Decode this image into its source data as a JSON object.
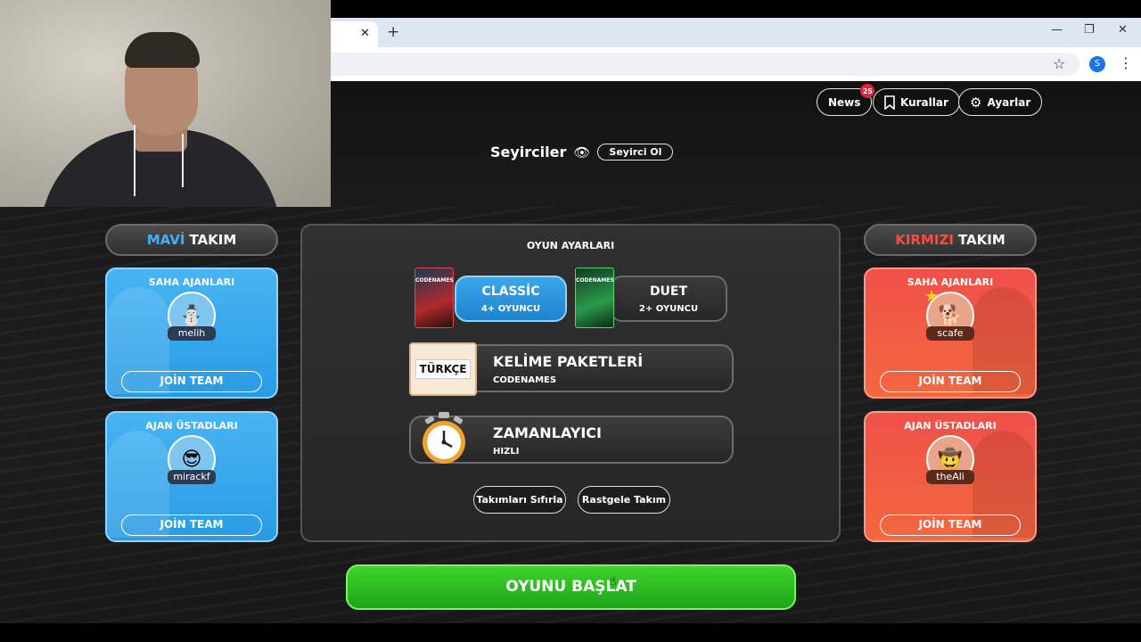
{
  "browser": {
    "tab_close": "✕",
    "new_tab": "+",
    "minimize": "—",
    "restore": "❐",
    "close": "✕",
    "profile_initial": "S"
  },
  "top_nav": {
    "news": "News",
    "news_badge": "25",
    "rules": "Kurallar",
    "settings": "Ayarlar"
  },
  "spectators": {
    "title": "Seyirciler",
    "button": "Seyirci Ol"
  },
  "blue_team": {
    "word1": "MAVİ",
    "word2": "TAKIM",
    "operatives_title": "SAHA AJANLARI",
    "operative_name": "melih",
    "spymasters_title": "AJAN ÜSTADLARI",
    "spymaster_name": "mirackf",
    "join": "JOİN TEAM"
  },
  "red_team": {
    "word1": "KIRMIZI",
    "word2": "TAKIM",
    "operatives_title": "SAHA AJANLARI",
    "operative_name": "scafe",
    "spymasters_title": "AJAN ÜSTADLARI",
    "spymaster_name": "theAli",
    "join": "JOİN TEAM"
  },
  "game_settings": {
    "title": "OYUN AYARLARI",
    "classic_name": "CLASSİC",
    "classic_sub": "4+ OYUNCU",
    "duet_name": "DUET",
    "duet_sub": "2+ OYUNCU",
    "box_label": "CODENAMES",
    "word_packs_name": "KELİME PAKETLERİ",
    "word_packs_sub": "CODENAMES",
    "pack_language": "TÜRKÇE",
    "timer_name": "ZAMANLAYICI",
    "timer_sub": "HIZLI",
    "reset_teams": "Takımları Sıfırla",
    "random_teams": "Rastgele Takım"
  },
  "start_button": "OYUNU BAŞLAT"
}
